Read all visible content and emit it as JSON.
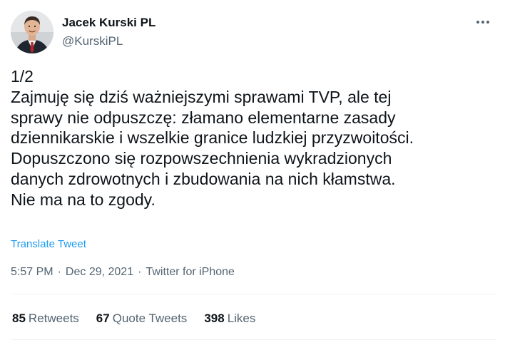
{
  "author": {
    "display_name": "Jacek Kurski PL",
    "handle": "@KurskiPL"
  },
  "icons": {
    "more": "more-horizontal-icon",
    "avatar": "profile-photo"
  },
  "tweet": {
    "lines": [
      "1/2",
      "Zajmuję się dziś ważniejszymi sprawami TVP, ale tej",
      "sprawy nie odpuszczę: złamano elementarne zasady",
      "dziennikarskie i wszelkie granice ludzkiej przyzwoitości.",
      "Dopuszczono się rozpowszechnienia wykradzionych",
      "danych zdrowotnych i zbudowania na nich kłamstwa.",
      "Nie ma na to zgody."
    ],
    "translate_label": "Translate Tweet",
    "time": "5:57 PM",
    "separator": "·",
    "date": "Dec 29, 2021",
    "source": "Twitter for iPhone"
  },
  "stats": {
    "retweets_count": "85",
    "retweets_label": "Retweets",
    "quotes_count": "67",
    "quotes_label": "Quote Tweets",
    "likes_count": "398",
    "likes_label": "Likes"
  },
  "colors": {
    "text": "#0f1419",
    "secondary": "#536471",
    "link": "#1d9bf0",
    "divider": "#eff3f4"
  }
}
